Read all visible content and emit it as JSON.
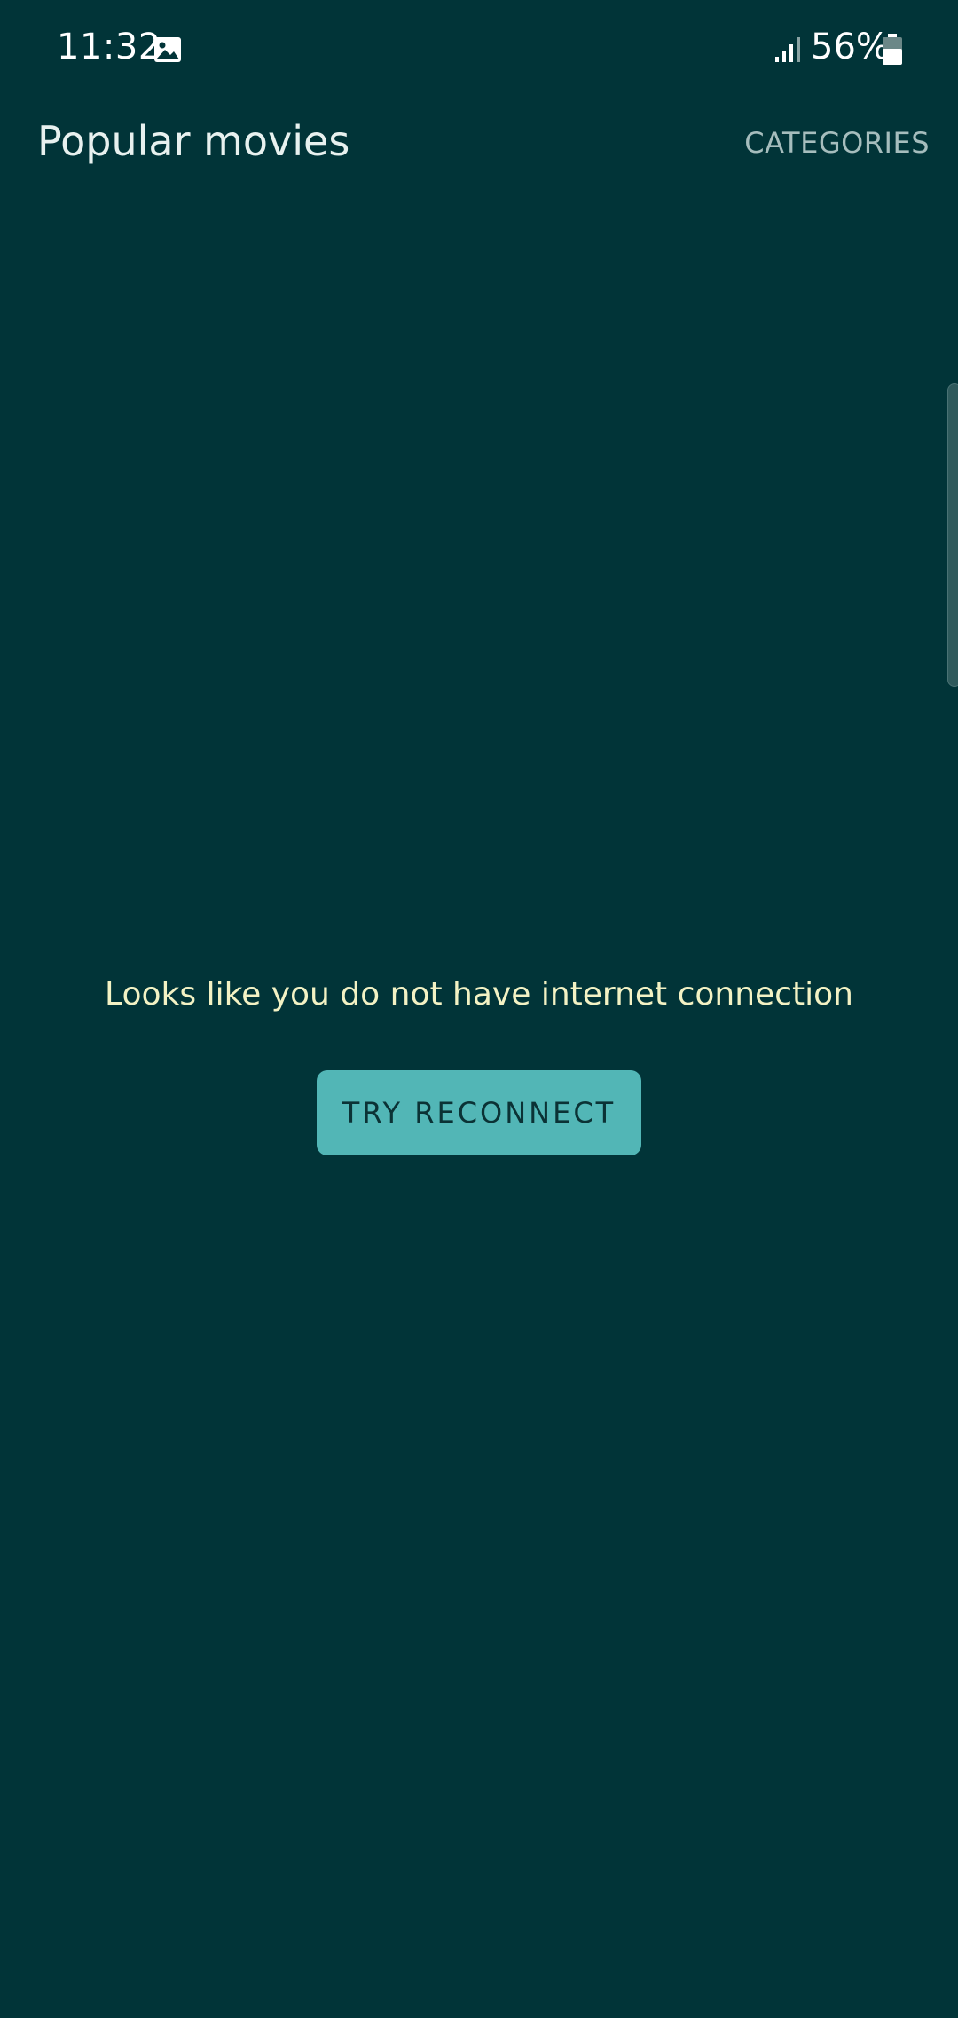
{
  "status_bar": {
    "time": "11:32",
    "battery": "56%",
    "icons": [
      "gallery-icon",
      "signal-icon",
      "battery-icon"
    ]
  },
  "app_bar": {
    "title": "Popular movies",
    "categories_label": "CATEGORIES"
  },
  "error_state": {
    "message": "Looks like you do not have internet connection",
    "button_label": "TRY RECONNECT"
  },
  "colors": {
    "background": "#013438",
    "accent": "#52b6b6",
    "message_text": "#f3f2c4",
    "secondary_text": "#a6bdbd"
  }
}
